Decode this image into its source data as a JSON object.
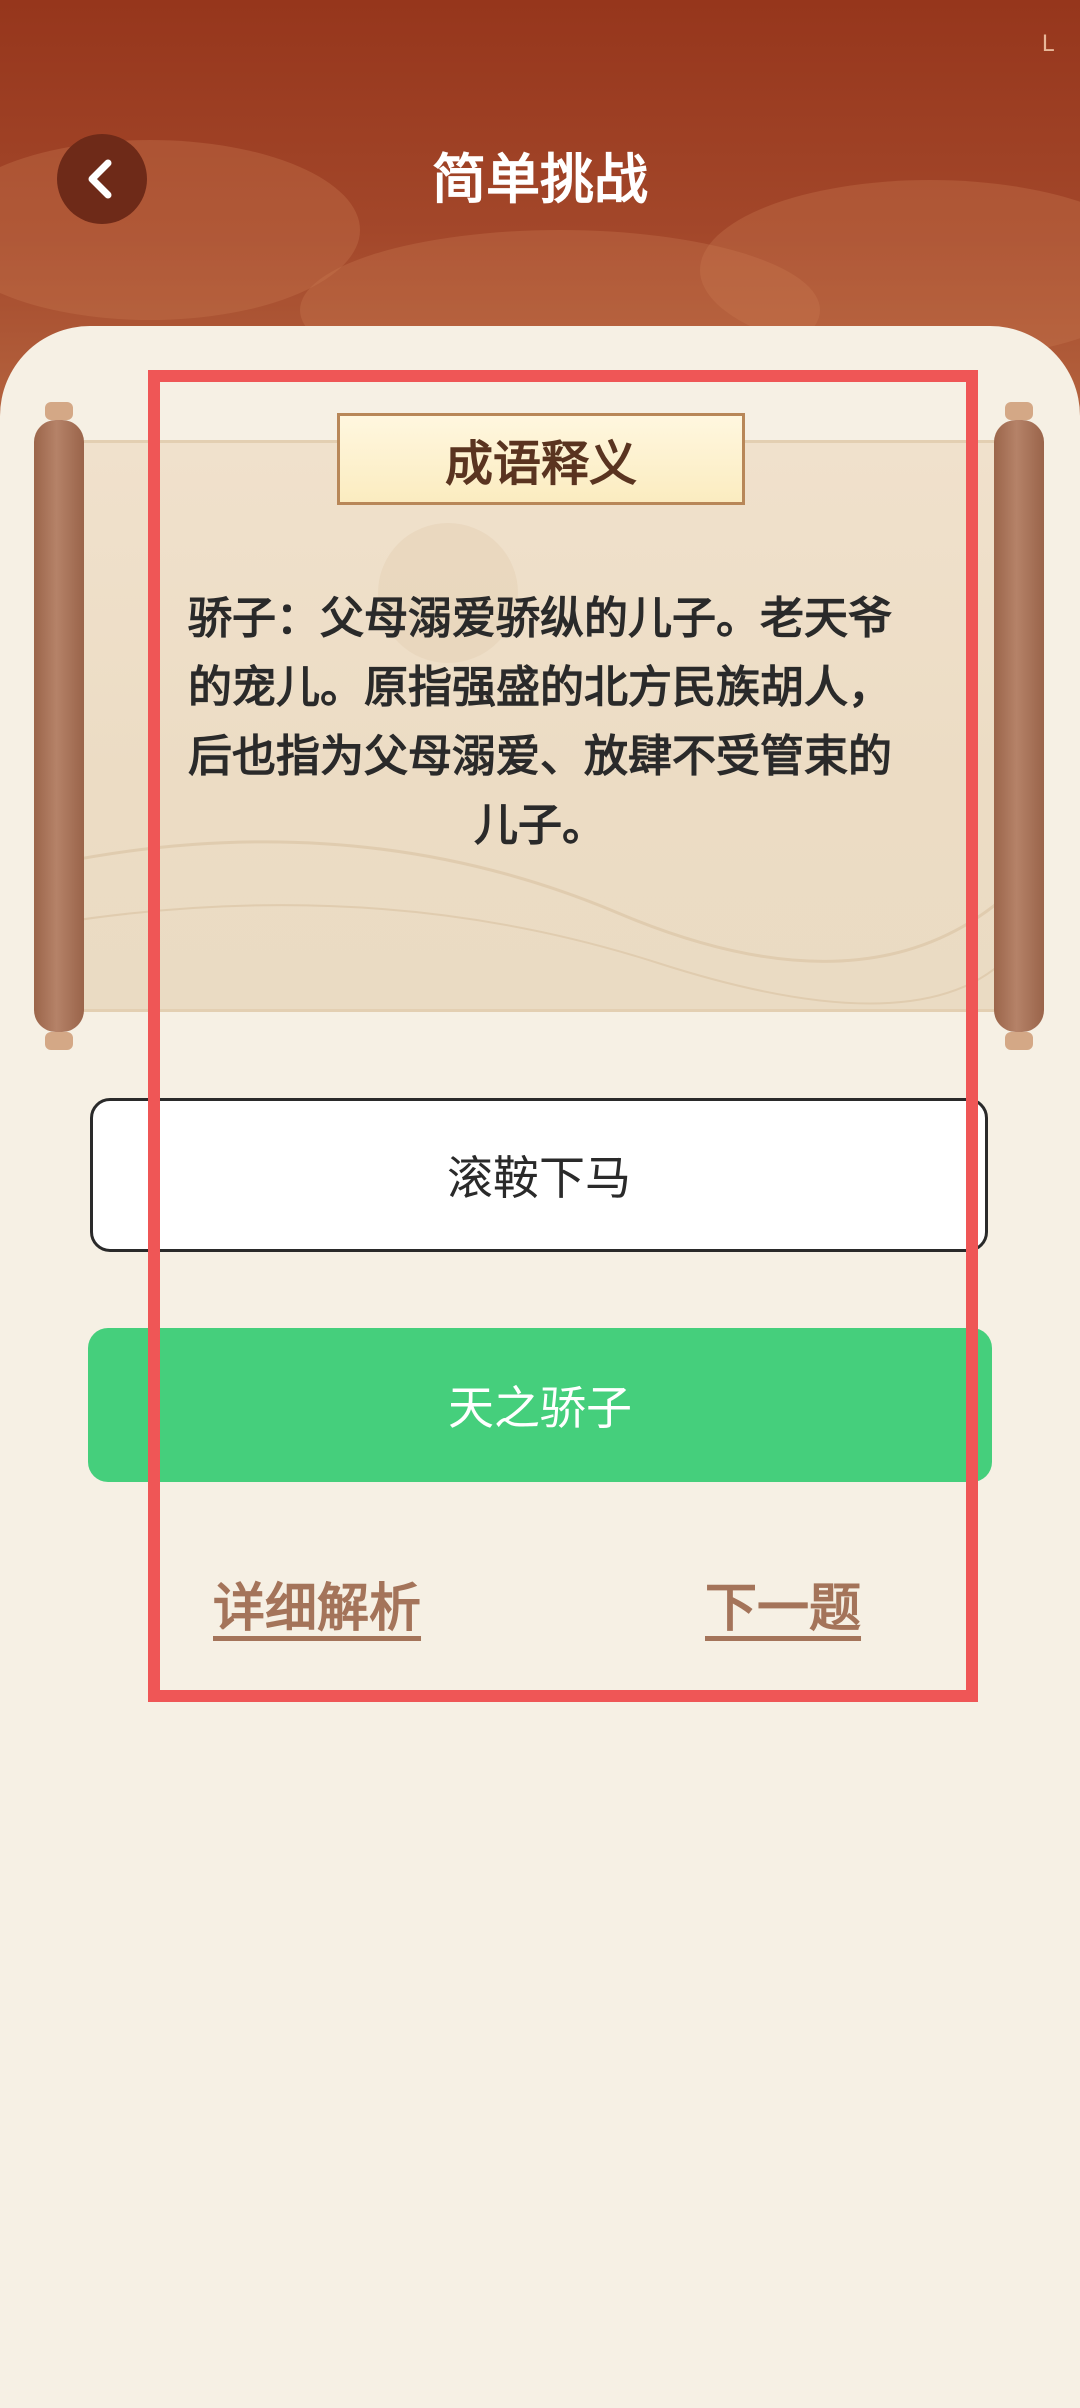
{
  "status_bar": {
    "corner_mark": "L"
  },
  "header": {
    "title": "简单挑战"
  },
  "card": {
    "label": "成语释义",
    "definition": "骄子：父母溺爱骄纵的儿子。老天爷的宠儿。原指强盛的北方民族胡人，后也指为父母溺爱、放肆不受管束的儿子。"
  },
  "options": [
    {
      "label": "滚鞍下马",
      "state": "unselected"
    },
    {
      "label": "天之骄子",
      "state": "correct"
    }
  ],
  "links": {
    "detail": "详细解析",
    "next": "下一题"
  },
  "colors": {
    "header": "#96361c",
    "background": "#f6f0e4",
    "correct": "#45cf7c",
    "link": "#a4745a",
    "highlight": "#ef5656"
  }
}
